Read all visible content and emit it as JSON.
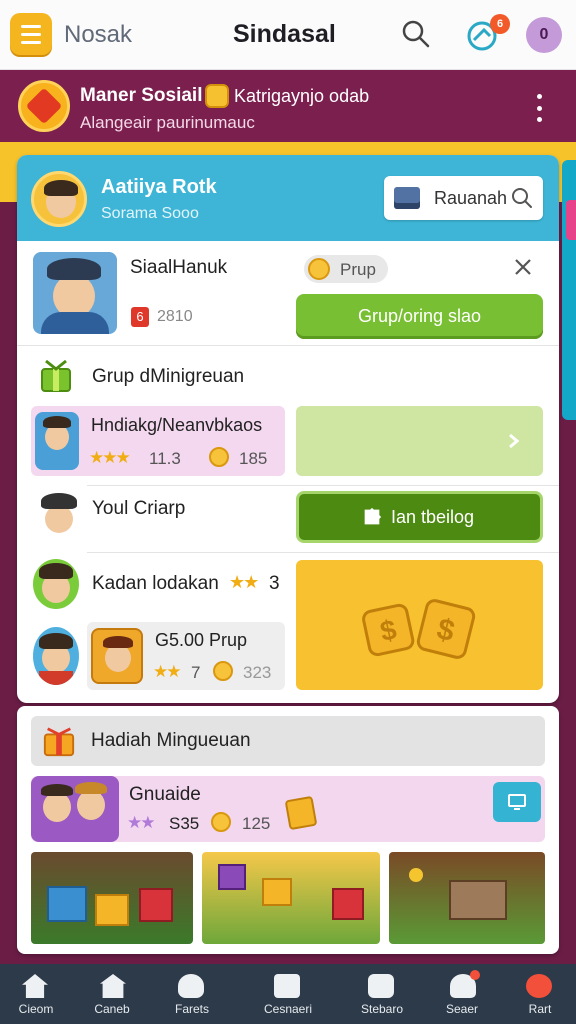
{
  "topbar": {
    "brand": "Nosak",
    "title": "Sindasal",
    "notification_count": "6",
    "profile_initial": "0"
  },
  "banner": {
    "title": "Maner Sosiail",
    "link": "Katrigaynjo odab",
    "subtitle": "Alangeair paurinumauc"
  },
  "card": {
    "header": {
      "name": "Aatiiya Rotk",
      "sub": "Sorama Sooo",
      "search_label": "Rauanah"
    },
    "player": {
      "name": "SiaalHanuk",
      "badge": "6",
      "score": "2810",
      "pill_label": "Prup",
      "button_label": "Grup/oring slao"
    },
    "group_label": "Grup dMinigreuan",
    "item1": {
      "name": "Hndiakg/Neanvbkaos",
      "rating": "11.3",
      "coins": "185"
    },
    "item2": {
      "name": "Youl Criarp",
      "button_label": "Ian tbeilog"
    },
    "item3": {
      "name": "Kadan lodakan",
      "rating": "3"
    },
    "item4": {
      "price": "G5.00 Prup",
      "rating": "7",
      "coins": "323"
    }
  },
  "section2": {
    "title": "Hadiah Mingueuan",
    "gift": {
      "name": "Gnuaide",
      "rating": "S35",
      "coins": "125"
    }
  },
  "bottomnav": {
    "items": [
      {
        "label": "Cieom",
        "icon": "home-icon"
      },
      {
        "label": "Caneb",
        "icon": "shop-icon"
      },
      {
        "label": "Farets",
        "icon": "friends-icon"
      },
      {
        "label": "Cesnaeri",
        "icon": "message-icon"
      },
      {
        "label": "Stebaro",
        "icon": "store-icon"
      },
      {
        "label": "Seaer",
        "icon": "user-icon"
      },
      {
        "label": "Rart",
        "icon": "event-icon"
      }
    ]
  },
  "colors": {
    "header_teal": "#3eb5d6",
    "banner_purple": "#7b1f4f",
    "accent_gold": "#f6c32b",
    "green": "#79bf33",
    "dark_green": "#4d8a12",
    "nav_dark": "#2c3a49"
  }
}
